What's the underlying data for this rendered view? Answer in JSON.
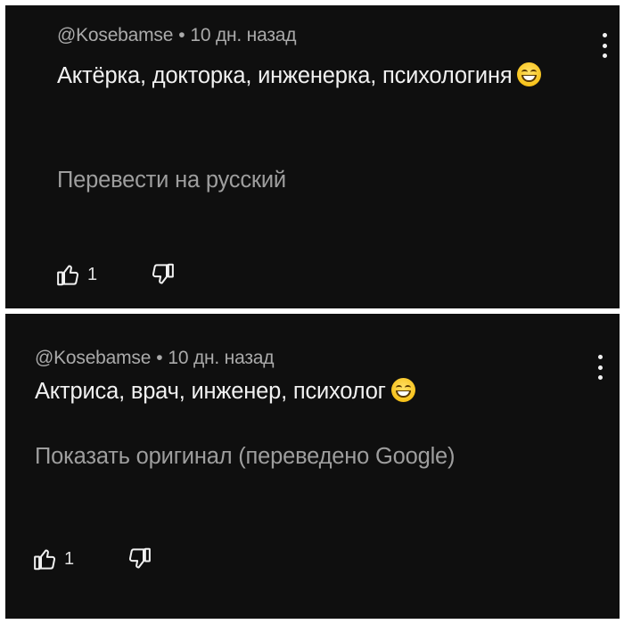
{
  "comments": [
    {
      "author": "@Kosebamse",
      "separator": "•",
      "time": "10 дн. назад",
      "text": "Актёрка, докторка, инженерка, психологиня",
      "emoji_icon": "grinning-face-icon",
      "translate_link": "Перевести на русский",
      "likes": "1"
    },
    {
      "author": "@Kosebamse",
      "separator": "•",
      "time": "10 дн. назад",
      "text": "Актриса, врач, инженер, психолог",
      "emoji_icon": "grinning-face-icon",
      "translate_link": "Показать оригинал (переведено Google)",
      "likes": "1"
    }
  ],
  "colors": {
    "background": "#0f0f0f",
    "text": "#f1f1f1",
    "meta": "#aaaaaa",
    "translate": "#9e9e9e",
    "frame": "#ffffff"
  }
}
